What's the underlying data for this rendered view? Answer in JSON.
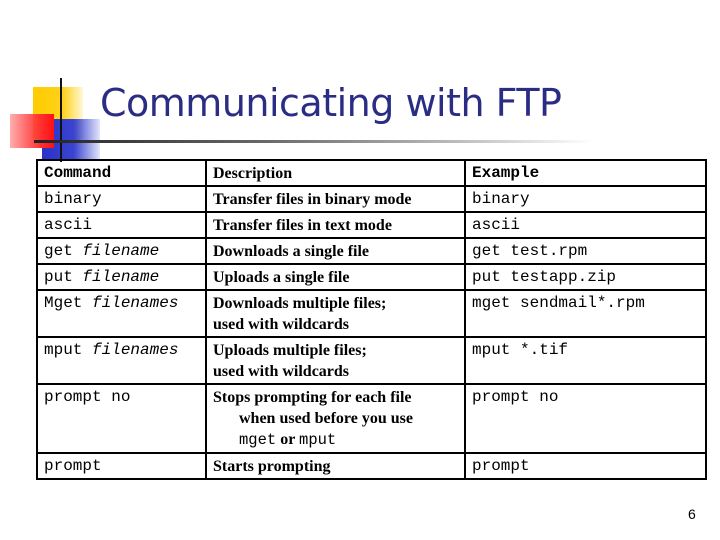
{
  "slide": {
    "title": "Communicating with FTP",
    "page_number": "6",
    "colors": {
      "title": "#2b2d84",
      "deco_yellow": "#ffcc00",
      "deco_blue": "#2a32c8",
      "deco_red": "#ff1010"
    }
  },
  "table": {
    "headers": {
      "command": "Command",
      "description": "Description",
      "example": "Example"
    },
    "rows": [
      {
        "cmd": "binary",
        "arg": "",
        "desc": "Transfer files in binary mode",
        "desc2": "",
        "example": "binary"
      },
      {
        "cmd": "ascii",
        "arg": "",
        "desc": "Transfer files in text mode",
        "desc2": "",
        "example": "ascii"
      },
      {
        "cmd": "get ",
        "arg": "filename",
        "desc": "Downloads a single file",
        "desc2": "",
        "example": "get test.rpm"
      },
      {
        "cmd": "put ",
        "arg": "filename",
        "desc": "Uploads a single file",
        "desc2": "",
        "example": "put testapp.zip"
      },
      {
        "cmd": "Mget ",
        "arg": "filenames",
        "desc": "Downloads multiple files;",
        "desc2": "used with wildcards",
        "example": "mget sendmail*.rpm"
      },
      {
        "cmd": "mput ",
        "arg": "filenames",
        "desc": "Uploads multiple files;",
        "desc2": "used with wildcards",
        "example": "mput *.tif"
      },
      {
        "cmd": "prompt no",
        "arg": "",
        "desc": "Stops prompting for each file",
        "desc2": "when used before you use",
        "desc3_code1": "mget",
        "desc3_or": " or ",
        "desc3_code2": "mput",
        "example": "prompt no"
      },
      {
        "cmd": "prompt",
        "arg": "",
        "desc": "Starts prompting",
        "desc2": "",
        "example": "prompt"
      }
    ]
  }
}
